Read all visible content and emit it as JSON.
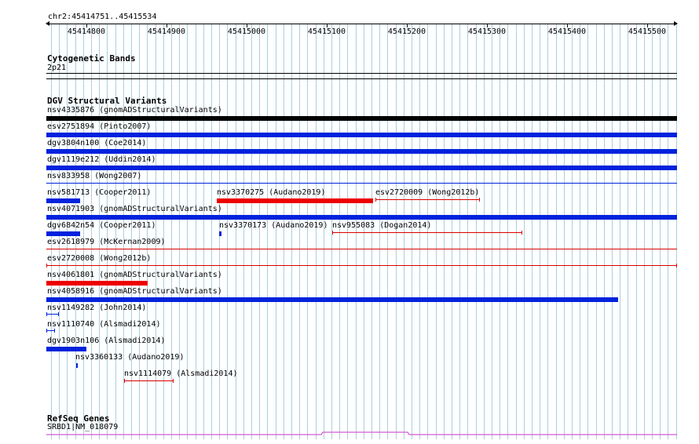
{
  "locus": "chr2:45414751..45415534",
  "ruler_ticks": [
    "45414800",
    "45414900",
    "45415000",
    "45415100",
    "45415200",
    "45415300",
    "45415400",
    "45415500"
  ],
  "tracks": {
    "cyto": {
      "title": "Cytogenetic Bands",
      "band": "2p21"
    },
    "dgv": {
      "title": "DGV Structural Variants",
      "items": [
        {
          "label": "nsv4335876 (gnomADStructuralVariants)",
          "color": "#000000"
        },
        {
          "label": "esv2751894 (Pinto2007)",
          "color": "#0022dd"
        },
        {
          "label": "dgv3804n100 (Coe2014)",
          "color": "#0022dd"
        },
        {
          "label": "dgv1119e212 (Uddin2014)",
          "color": "#0022dd"
        },
        {
          "label": "nsv833958 (Wong2007)",
          "color": "#0022dd"
        },
        {
          "label": "nsv581713 (Cooper2011)",
          "color": "#0022dd"
        },
        {
          "label": "nsv3370275 (Audano2019)",
          "color": "#ee0000"
        },
        {
          "label": "esv2720009 (Wong2012b)",
          "color": "#dd0000"
        },
        {
          "label": "nsv4071903 (gnomADStructuralVariants)",
          "color": "#0022dd"
        },
        {
          "label": "dgv6842n54 (Cooper2011)",
          "color": "#0022dd"
        },
        {
          "label": "nsv3370173 (Audano2019)",
          "color": "#0022dd"
        },
        {
          "label": "nsv955083 (Dogan2014)",
          "color": "#dd0000"
        },
        {
          "label": "esv2618979 (McKernan2009)",
          "color": "#dd0000"
        },
        {
          "label": "esv2720008 (Wong2012b)",
          "color": "#dd0000"
        },
        {
          "label": "nsv4061801 (gnomADStructuralVariants)",
          "color": "#ee0000"
        },
        {
          "label": "nsv4058916 (gnomADStructuralVariants)",
          "color": "#0022dd"
        },
        {
          "label": "nsv1149282 (John2014)",
          "color": "#0022dd"
        },
        {
          "label": "nsv1110740 (Alsmadi2014)",
          "color": "#0022dd"
        },
        {
          "label": "dgv1903n106 (Alsmadi2014)",
          "color": "#0022dd"
        },
        {
          "label": "nsv3360133 (Audano2019)",
          "color": "#0022dd"
        },
        {
          "label": "nsv1114079 (Alsmadi2014)",
          "color": "#dd0000"
        }
      ]
    },
    "refseq": {
      "title": "RefSeq Genes",
      "gene": "SRBD1|NM_018079",
      "color": "#cc33cc"
    }
  }
}
